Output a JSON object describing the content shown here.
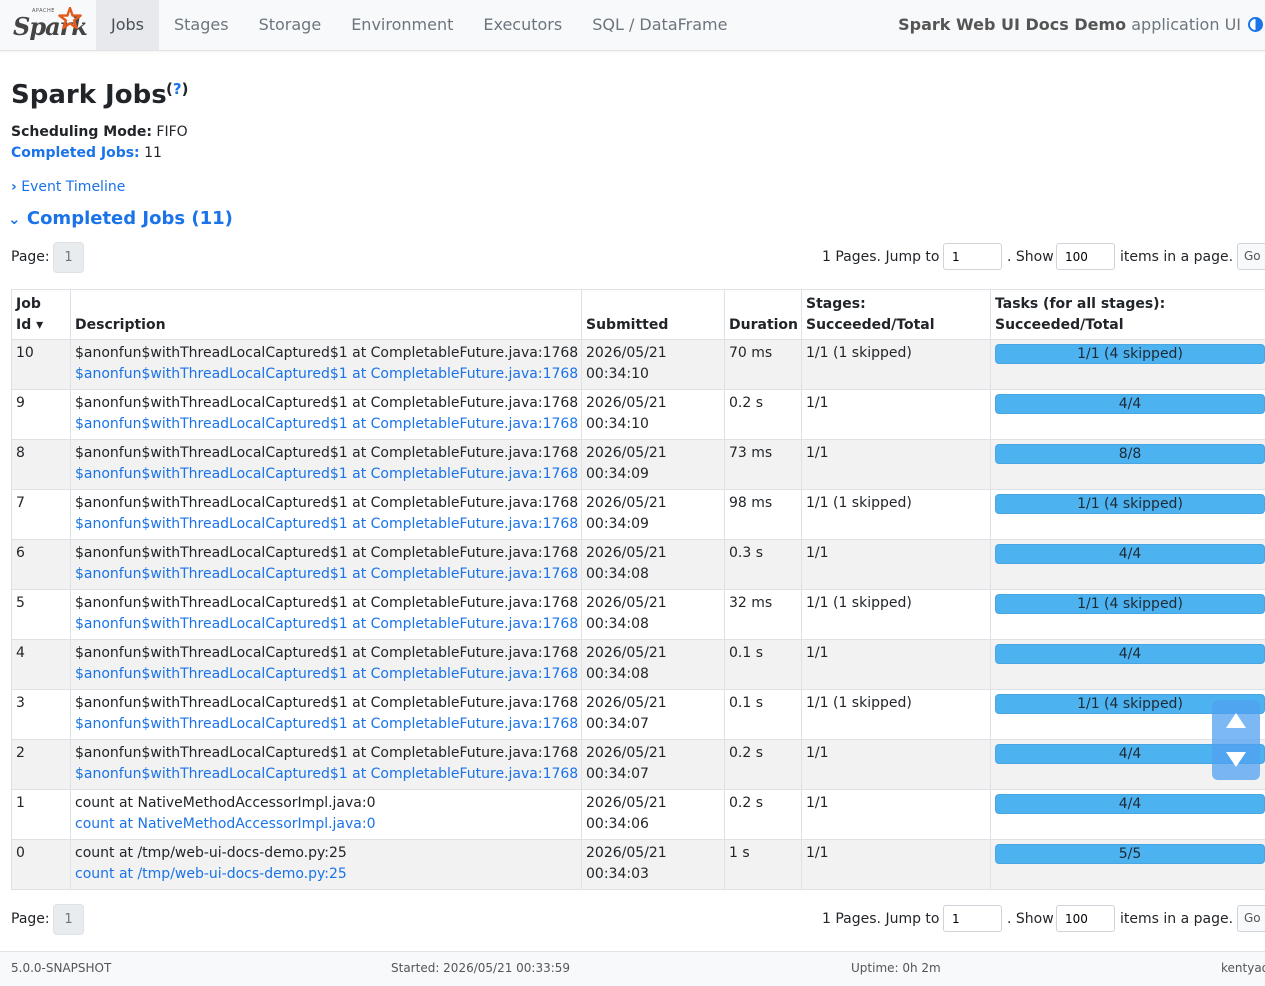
{
  "brand": {
    "apache": "APACHE",
    "name": "Spark"
  },
  "nav": {
    "items": [
      "Jobs",
      "Stages",
      "Storage",
      "Environment",
      "Executors",
      "SQL / DataFrame"
    ],
    "app_name": "Spark Web UI Docs Demo",
    "app_suffix": " application UI"
  },
  "page": {
    "title": "Spark Jobs",
    "help": "?",
    "scheduling_label": "Scheduling Mode:",
    "scheduling_value": "FIFO",
    "completed_label": "Completed Jobs:",
    "completed_value": "11",
    "timeline_link": "Event Timeline",
    "section_title": "Completed Jobs (11)"
  },
  "pager": {
    "page_label": "Page:",
    "current_page": "1",
    "jump_text": "1 Pages. Jump to",
    "jump_value": "1",
    "show_text": ". Show",
    "show_value": "100",
    "items_text": "items in a page.",
    "go_label": "Go"
  },
  "table": {
    "headers": {
      "job_id_line1": "Job",
      "job_id_line2": "Id ▾",
      "description": "Description",
      "submitted": "Submitted",
      "duration": "Duration",
      "stages_line1": "Stages:",
      "stages_line2": "Succeeded/Total",
      "tasks_line1": "Tasks (for all stages):",
      "tasks_line2": "Succeeded/Total"
    },
    "rows": [
      {
        "id": "10",
        "desc": "$anonfun$withThreadLocalCaptured$1 at CompletableFuture.java:1768",
        "link": "$anonfun$withThreadLocalCaptured$1 at CompletableFuture.java:1768",
        "date": "2026/05/21",
        "time": "00:34:10",
        "duration": "70 ms",
        "stages": "1/1 (1 skipped)",
        "tasks": "1/1 (4 skipped)",
        "progress": 1.0
      },
      {
        "id": "9",
        "desc": "$anonfun$withThreadLocalCaptured$1 at CompletableFuture.java:1768",
        "link": "$anonfun$withThreadLocalCaptured$1 at CompletableFuture.java:1768",
        "date": "2026/05/21",
        "time": "00:34:10",
        "duration": "0.2 s",
        "stages": "1/1",
        "tasks": "4/4",
        "progress": 1.0
      },
      {
        "id": "8",
        "desc": "$anonfun$withThreadLocalCaptured$1 at CompletableFuture.java:1768",
        "link": "$anonfun$withThreadLocalCaptured$1 at CompletableFuture.java:1768",
        "date": "2026/05/21",
        "time": "00:34:09",
        "duration": "73 ms",
        "stages": "1/1",
        "tasks": "8/8",
        "progress": 1.0
      },
      {
        "id": "7",
        "desc": "$anonfun$withThreadLocalCaptured$1 at CompletableFuture.java:1768",
        "link": "$anonfun$withThreadLocalCaptured$1 at CompletableFuture.java:1768",
        "date": "2026/05/21",
        "time": "00:34:09",
        "duration": "98 ms",
        "stages": "1/1 (1 skipped)",
        "tasks": "1/1 (4 skipped)",
        "progress": 1.0
      },
      {
        "id": "6",
        "desc": "$anonfun$withThreadLocalCaptured$1 at CompletableFuture.java:1768",
        "link": "$anonfun$withThreadLocalCaptured$1 at CompletableFuture.java:1768",
        "date": "2026/05/21",
        "time": "00:34:08",
        "duration": "0.3 s",
        "stages": "1/1",
        "tasks": "4/4",
        "progress": 1.0
      },
      {
        "id": "5",
        "desc": "$anonfun$withThreadLocalCaptured$1 at CompletableFuture.java:1768",
        "link": "$anonfun$withThreadLocalCaptured$1 at CompletableFuture.java:1768",
        "date": "2026/05/21",
        "time": "00:34:08",
        "duration": "32 ms",
        "stages": "1/1 (1 skipped)",
        "tasks": "1/1 (4 skipped)",
        "progress": 1.0
      },
      {
        "id": "4",
        "desc": "$anonfun$withThreadLocalCaptured$1 at CompletableFuture.java:1768",
        "link": "$anonfun$withThreadLocalCaptured$1 at CompletableFuture.java:1768",
        "date": "2026/05/21",
        "time": "00:34:08",
        "duration": "0.1 s",
        "stages": "1/1",
        "tasks": "4/4",
        "progress": 1.0
      },
      {
        "id": "3",
        "desc": "$anonfun$withThreadLocalCaptured$1 at CompletableFuture.java:1768",
        "link": "$anonfun$withThreadLocalCaptured$1 at CompletableFuture.java:1768",
        "date": "2026/05/21",
        "time": "00:34:07",
        "duration": "0.1 s",
        "stages": "1/1 (1 skipped)",
        "tasks": "1/1 (4 skipped)",
        "progress": 1.0
      },
      {
        "id": "2",
        "desc": "$anonfun$withThreadLocalCaptured$1 at CompletableFuture.java:1768",
        "link": "$anonfun$withThreadLocalCaptured$1 at CompletableFuture.java:1768",
        "date": "2026/05/21",
        "time": "00:34:07",
        "duration": "0.2 s",
        "stages": "1/1",
        "tasks": "4/4",
        "progress": 1.0
      },
      {
        "id": "1",
        "desc": "count at NativeMethodAccessorImpl.java:0",
        "link": "count at NativeMethodAccessorImpl.java:0",
        "date": "2026/05/21",
        "time": "00:34:06",
        "duration": "0.2 s",
        "stages": "1/1",
        "tasks": "4/4",
        "progress": 1.0
      },
      {
        "id": "0",
        "desc": "count at /tmp/web-ui-docs-demo.py:25",
        "link": "count at /tmp/web-ui-docs-demo.py:25",
        "date": "2026/05/21",
        "time": "00:34:03",
        "duration": "1 s",
        "stages": "1/1",
        "tasks": "5/5",
        "progress": 1.0
      }
    ]
  },
  "footer": {
    "version": "5.0.0-SNAPSHOT",
    "started": "Started: 2026/05/21 00:33:59",
    "uptime": "Uptime: 0h 2m",
    "user": "kentyao"
  },
  "colors": {
    "link": "#1a73e8",
    "progress_bar": "#4db2f0",
    "scroll_buttons": "#50a0f0"
  },
  "icons": {
    "theme": "theme-toggle-icon",
    "scroll_up": "arrow-up-icon",
    "scroll_down": "arrow-down-icon",
    "expand": "chevron-right-icon",
    "collapse": "chevron-down-icon"
  }
}
